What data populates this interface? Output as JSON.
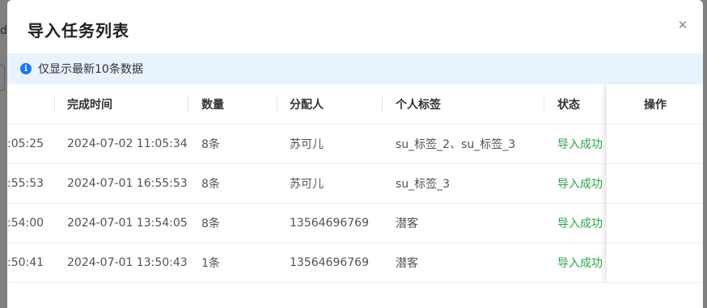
{
  "background": {
    "fragment_text": "d,"
  },
  "dialog": {
    "title": "导入任务列表",
    "close_icon": "close-icon"
  },
  "alert": {
    "icon": "info-icon",
    "icon_glyph": "i",
    "text": "仅显示最新10条数据"
  },
  "table": {
    "columns": {
      "finish_time": "完成时间",
      "count": "数量",
      "assignee": "分配人",
      "tags": "个人标签",
      "status": "状态",
      "actions": "操作"
    },
    "rows": [
      {
        "start_time": ":05:25",
        "finish_time": "2024-07-02 11:05:34",
        "count": "8条",
        "assignee": "苏可儿",
        "tags": "su_标签_2、su_标签_3",
        "status": "导入成功"
      },
      {
        "start_time": ":55:53",
        "finish_time": "2024-07-01 16:55:53",
        "count": "8条",
        "assignee": "苏可儿",
        "tags": "su_标签_3",
        "status": "导入成功"
      },
      {
        "start_time": ":54:00",
        "finish_time": "2024-07-01 13:54:05",
        "count": "8条",
        "assignee": "13564696769",
        "tags": "潜客",
        "status": "导入成功"
      },
      {
        "start_time": ":50:41",
        "finish_time": "2024-07-01 13:50:43",
        "count": "1条",
        "assignee": "13564696769",
        "tags": "潜客",
        "status": "导入成功"
      }
    ]
  },
  "colors": {
    "status_success": "#27a745",
    "alert_background": "#e8f3fd",
    "info_icon": "#1677ff"
  }
}
